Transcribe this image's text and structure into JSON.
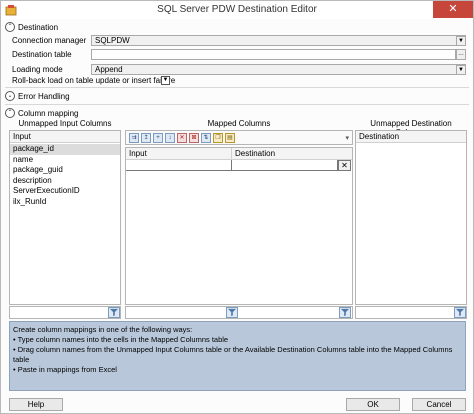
{
  "window": {
    "title": "SQL Server PDW Destination Editor",
    "close_glyph": "✕"
  },
  "destination": {
    "section_label": "Destination",
    "connection_manager_label": "Connection manager",
    "connection_manager_value": "SQLPDW",
    "destination_table_label": "Destination table",
    "destination_table_value": "",
    "loading_mode_label": "Loading mode",
    "loading_mode_value": "Append",
    "rollback_label": "Roll-back load on table update or insert failure"
  },
  "error_handling": {
    "section_label": "Error Handling"
  },
  "column_mapping": {
    "section_label": "Column mapping",
    "unmapped_input": {
      "title": "Unmapped Input Columns",
      "header": "Input",
      "items": [
        "package_id",
        "name",
        "package_guid",
        "description",
        "ServerExecutionID",
        "ilx_RunId"
      ]
    },
    "mapped": {
      "title": "Mapped Columns",
      "col_input": "Input",
      "col_destination": "Destination"
    },
    "unmapped_destination": {
      "title": "Unmapped Destination Columns",
      "header": "Destination"
    }
  },
  "info": {
    "lines": [
      "Create column mappings in one of the following ways:",
      "• Type column names into the cells in the Mapped Columns table",
      "• Drag column names from the Unmapped Input Columns table or the Available Destination Columns table into the Mapped Columns table",
      "• Paste in mappings from Excel"
    ]
  },
  "buttons": {
    "help": "Help",
    "ok": "OK",
    "cancel": "Cancel"
  }
}
